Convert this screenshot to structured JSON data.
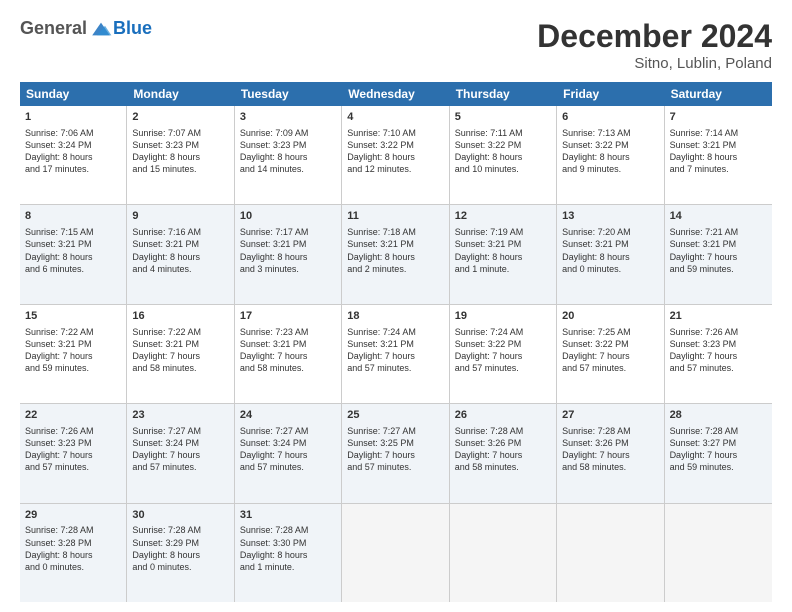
{
  "header": {
    "logo_general": "General",
    "logo_blue": "Blue",
    "month_title": "December 2024",
    "location": "Sitno, Lublin, Poland"
  },
  "days_of_week": [
    "Sunday",
    "Monday",
    "Tuesday",
    "Wednesday",
    "Thursday",
    "Friday",
    "Saturday"
  ],
  "weeks": [
    [
      {
        "day": "1",
        "lines": [
          "Sunrise: 7:06 AM",
          "Sunset: 3:24 PM",
          "Daylight: 8 hours",
          "and 17 minutes."
        ]
      },
      {
        "day": "2",
        "lines": [
          "Sunrise: 7:07 AM",
          "Sunset: 3:23 PM",
          "Daylight: 8 hours",
          "and 15 minutes."
        ]
      },
      {
        "day": "3",
        "lines": [
          "Sunrise: 7:09 AM",
          "Sunset: 3:23 PM",
          "Daylight: 8 hours",
          "and 14 minutes."
        ]
      },
      {
        "day": "4",
        "lines": [
          "Sunrise: 7:10 AM",
          "Sunset: 3:22 PM",
          "Daylight: 8 hours",
          "and 12 minutes."
        ]
      },
      {
        "day": "5",
        "lines": [
          "Sunrise: 7:11 AM",
          "Sunset: 3:22 PM",
          "Daylight: 8 hours",
          "and 10 minutes."
        ]
      },
      {
        "day": "6",
        "lines": [
          "Sunrise: 7:13 AM",
          "Sunset: 3:22 PM",
          "Daylight: 8 hours",
          "and 9 minutes."
        ]
      },
      {
        "day": "7",
        "lines": [
          "Sunrise: 7:14 AM",
          "Sunset: 3:21 PM",
          "Daylight: 8 hours",
          "and 7 minutes."
        ]
      }
    ],
    [
      {
        "day": "8",
        "lines": [
          "Sunrise: 7:15 AM",
          "Sunset: 3:21 PM",
          "Daylight: 8 hours",
          "and 6 minutes."
        ]
      },
      {
        "day": "9",
        "lines": [
          "Sunrise: 7:16 AM",
          "Sunset: 3:21 PM",
          "Daylight: 8 hours",
          "and 4 minutes."
        ]
      },
      {
        "day": "10",
        "lines": [
          "Sunrise: 7:17 AM",
          "Sunset: 3:21 PM",
          "Daylight: 8 hours",
          "and 3 minutes."
        ]
      },
      {
        "day": "11",
        "lines": [
          "Sunrise: 7:18 AM",
          "Sunset: 3:21 PM",
          "Daylight: 8 hours",
          "and 2 minutes."
        ]
      },
      {
        "day": "12",
        "lines": [
          "Sunrise: 7:19 AM",
          "Sunset: 3:21 PM",
          "Daylight: 8 hours",
          "and 1 minute."
        ]
      },
      {
        "day": "13",
        "lines": [
          "Sunrise: 7:20 AM",
          "Sunset: 3:21 PM",
          "Daylight: 8 hours",
          "and 0 minutes."
        ]
      },
      {
        "day": "14",
        "lines": [
          "Sunrise: 7:21 AM",
          "Sunset: 3:21 PM",
          "Daylight: 7 hours",
          "and 59 minutes."
        ]
      }
    ],
    [
      {
        "day": "15",
        "lines": [
          "Sunrise: 7:22 AM",
          "Sunset: 3:21 PM",
          "Daylight: 7 hours",
          "and 59 minutes."
        ]
      },
      {
        "day": "16",
        "lines": [
          "Sunrise: 7:22 AM",
          "Sunset: 3:21 PM",
          "Daylight: 7 hours",
          "and 58 minutes."
        ]
      },
      {
        "day": "17",
        "lines": [
          "Sunrise: 7:23 AM",
          "Sunset: 3:21 PM",
          "Daylight: 7 hours",
          "and 58 minutes."
        ]
      },
      {
        "day": "18",
        "lines": [
          "Sunrise: 7:24 AM",
          "Sunset: 3:21 PM",
          "Daylight: 7 hours",
          "and 57 minutes."
        ]
      },
      {
        "day": "19",
        "lines": [
          "Sunrise: 7:24 AM",
          "Sunset: 3:22 PM",
          "Daylight: 7 hours",
          "and 57 minutes."
        ]
      },
      {
        "day": "20",
        "lines": [
          "Sunrise: 7:25 AM",
          "Sunset: 3:22 PM",
          "Daylight: 7 hours",
          "and 57 minutes."
        ]
      },
      {
        "day": "21",
        "lines": [
          "Sunrise: 7:26 AM",
          "Sunset: 3:23 PM",
          "Daylight: 7 hours",
          "and 57 minutes."
        ]
      }
    ],
    [
      {
        "day": "22",
        "lines": [
          "Sunrise: 7:26 AM",
          "Sunset: 3:23 PM",
          "Daylight: 7 hours",
          "and 57 minutes."
        ]
      },
      {
        "day": "23",
        "lines": [
          "Sunrise: 7:27 AM",
          "Sunset: 3:24 PM",
          "Daylight: 7 hours",
          "and 57 minutes."
        ]
      },
      {
        "day": "24",
        "lines": [
          "Sunrise: 7:27 AM",
          "Sunset: 3:24 PM",
          "Daylight: 7 hours",
          "and 57 minutes."
        ]
      },
      {
        "day": "25",
        "lines": [
          "Sunrise: 7:27 AM",
          "Sunset: 3:25 PM",
          "Daylight: 7 hours",
          "and 57 minutes."
        ]
      },
      {
        "day": "26",
        "lines": [
          "Sunrise: 7:28 AM",
          "Sunset: 3:26 PM",
          "Daylight: 7 hours",
          "and 58 minutes."
        ]
      },
      {
        "day": "27",
        "lines": [
          "Sunrise: 7:28 AM",
          "Sunset: 3:26 PM",
          "Daylight: 7 hours",
          "and 58 minutes."
        ]
      },
      {
        "day": "28",
        "lines": [
          "Sunrise: 7:28 AM",
          "Sunset: 3:27 PM",
          "Daylight: 7 hours",
          "and 59 minutes."
        ]
      }
    ],
    [
      {
        "day": "29",
        "lines": [
          "Sunrise: 7:28 AM",
          "Sunset: 3:28 PM",
          "Daylight: 8 hours",
          "and 0 minutes."
        ]
      },
      {
        "day": "30",
        "lines": [
          "Sunrise: 7:28 AM",
          "Sunset: 3:29 PM",
          "Daylight: 8 hours",
          "and 0 minutes."
        ]
      },
      {
        "day": "31",
        "lines": [
          "Sunrise: 7:28 AM",
          "Sunset: 3:30 PM",
          "Daylight: 8 hours",
          "and 1 minute."
        ]
      },
      {
        "day": "",
        "lines": []
      },
      {
        "day": "",
        "lines": []
      },
      {
        "day": "",
        "lines": []
      },
      {
        "day": "",
        "lines": []
      }
    ]
  ]
}
